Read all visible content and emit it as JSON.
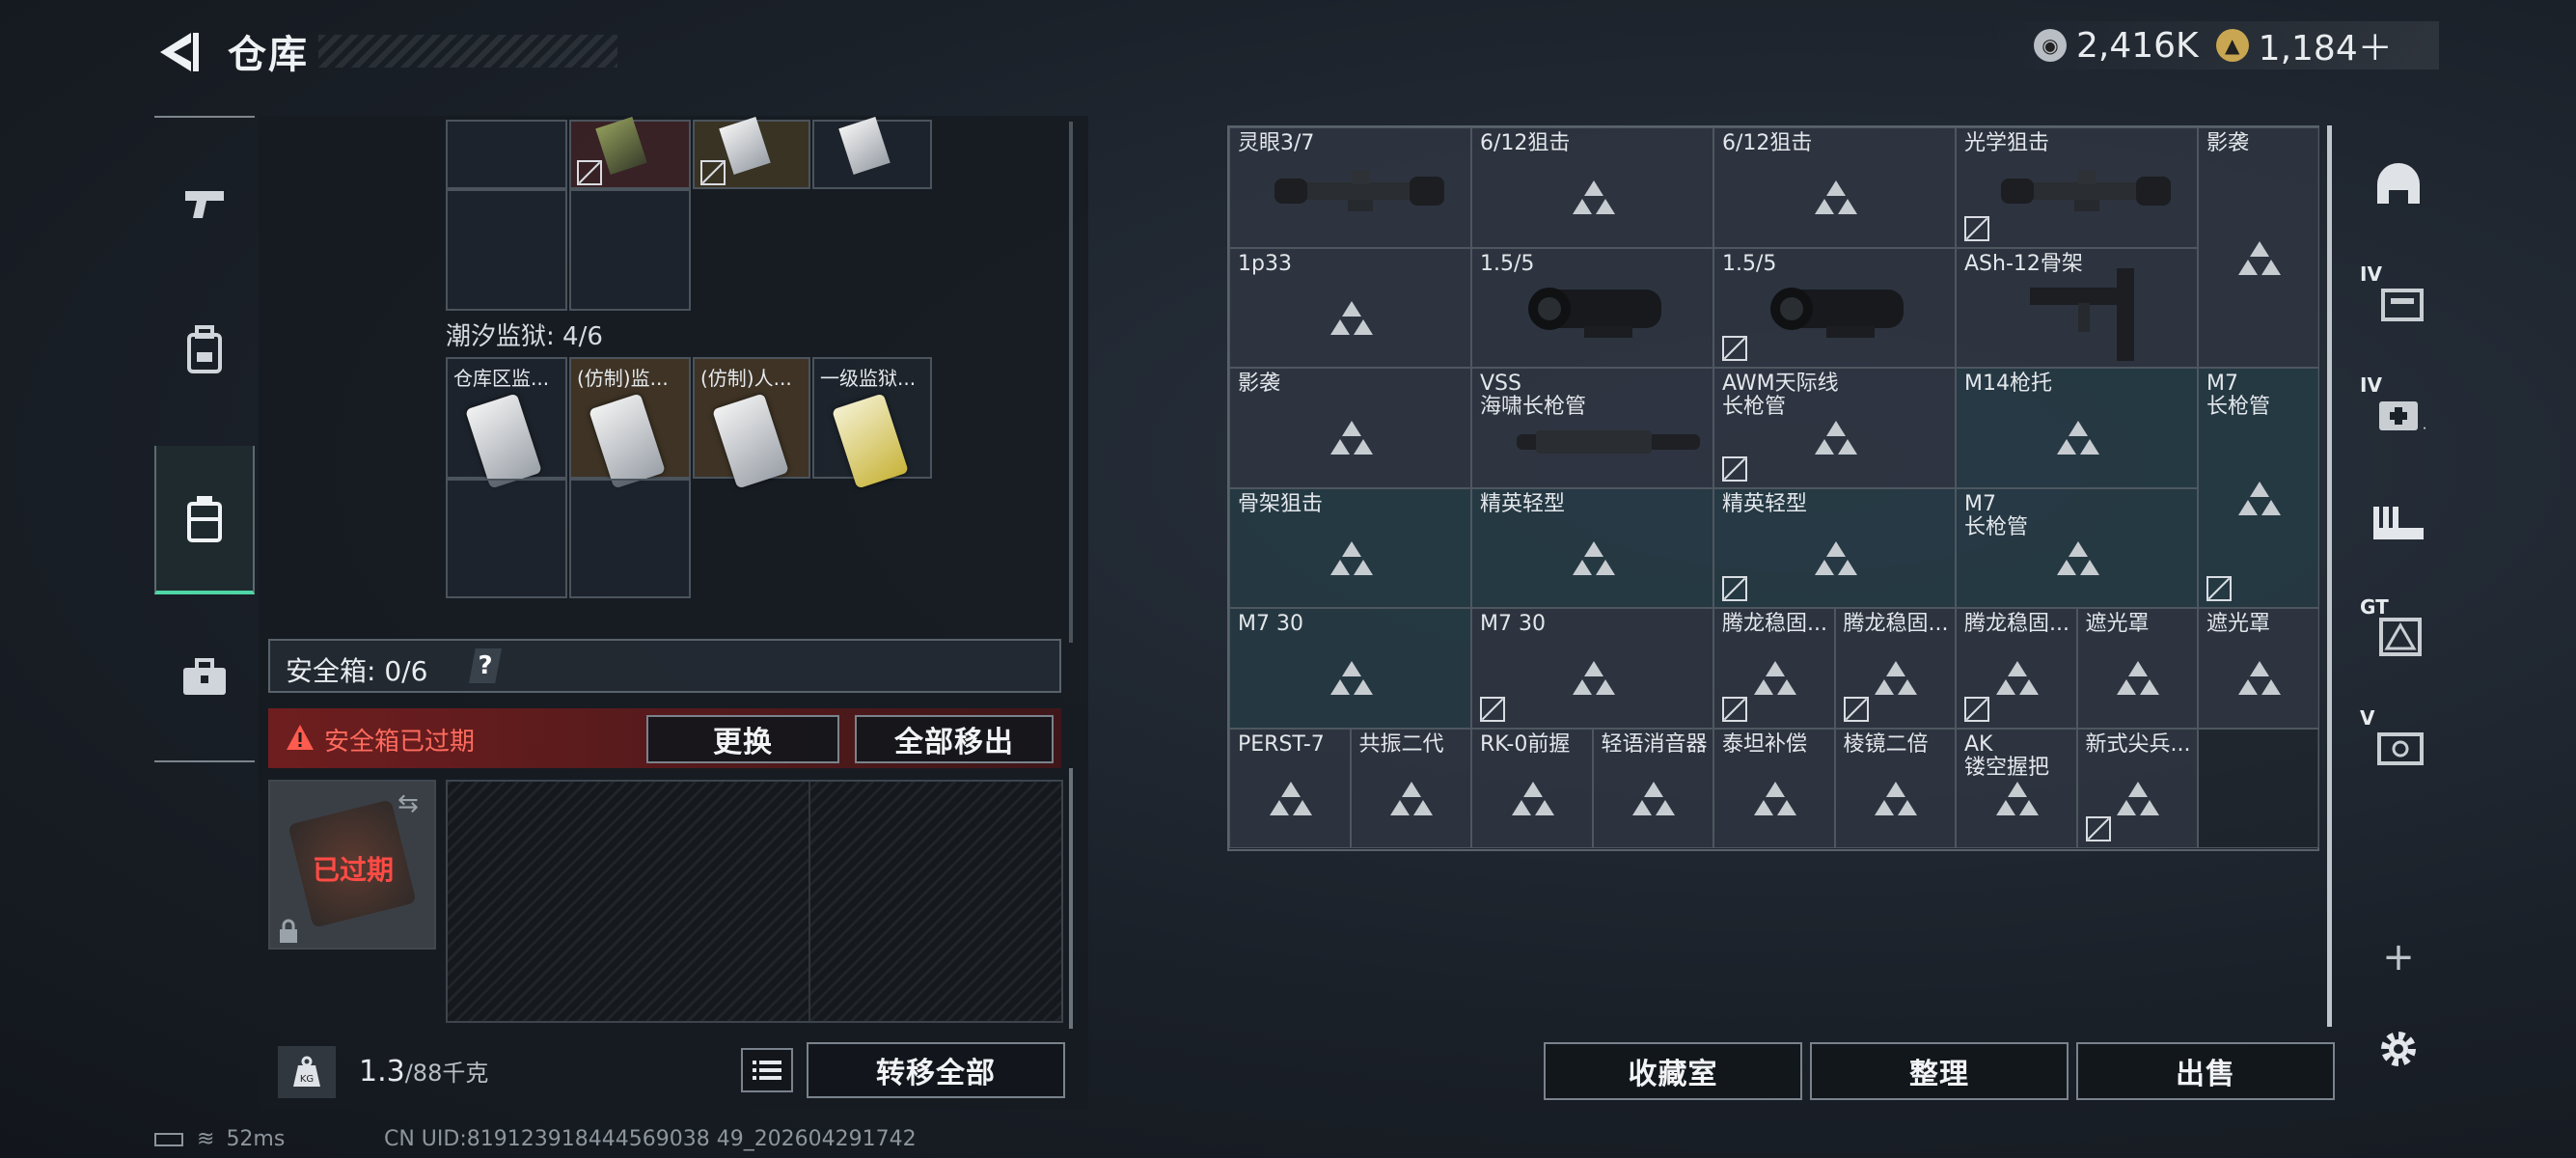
{
  "header": {
    "title": "仓库",
    "currency": [
      {
        "icon": "silver-coin-icon",
        "value": "2,416K",
        "color": "#c9ced3"
      },
      {
        "icon": "gold-coin-icon",
        "value": "1,184＋",
        "color": "#c9a651"
      }
    ]
  },
  "left_nav": [
    {
      "icon": "pistol-icon"
    },
    {
      "icon": "backpack-icon"
    },
    {
      "icon": "chest-rig-icon",
      "active": true
    },
    {
      "icon": "toolbox-icon"
    }
  ],
  "tide_prison": {
    "label": "潮汐监狱: 4/6",
    "cards": [
      "仓库区监...",
      "(仿制)监...",
      "(仿制)人...",
      "一级监狱..."
    ]
  },
  "safebox": {
    "label": "安全箱: 0/6",
    "help": "?",
    "alert": "安全箱已过期",
    "replace_btn": "更换",
    "remove_all_btn": "全部移出",
    "expired_label": "已过期"
  },
  "bottom": {
    "weight_current": "1.3",
    "weight_max": "/88千克",
    "kg_icon": "KG",
    "transfer_all_btn": "转移全部"
  },
  "status_bar": {
    "ping": "52ms",
    "uid": "CN UID:819123918444569038 49_202604291742"
  },
  "grid": {
    "cells": [
      {
        "id": "c0",
        "text": "灵眼3/7",
        "item": "scope"
      },
      {
        "id": "c1",
        "text": "6/12狙击"
      },
      {
        "id": "c2",
        "text": "6/12狙击"
      },
      {
        "id": "c3",
        "text": "光学狙击",
        "item": "scope",
        "noshow": true
      },
      {
        "id": "c4",
        "text": "影袭"
      },
      {
        "id": "c5",
        "text": "1p33"
      },
      {
        "id": "c6",
        "text": "1.5/5",
        "item": "nv"
      },
      {
        "id": "c7",
        "text": "1.5/5",
        "item": "nv",
        "noshow": true
      },
      {
        "id": "c8",
        "text": "ASh-12骨架",
        "item": "stock"
      },
      {
        "id": "c9",
        "text": "影袭"
      },
      {
        "id": "c10",
        "text": "VSS",
        "text2": "海啸长枪管",
        "item": "barrel"
      },
      {
        "id": "c11",
        "text": "AWM天际线",
        "text2": "长枪管",
        "noshow": true
      },
      {
        "id": "c12",
        "text": "M14枪托"
      },
      {
        "id": "c13",
        "text": "M7",
        "text2": "长枪管",
        "noshow": true
      },
      {
        "id": "c14",
        "text": "骨架狙击"
      },
      {
        "id": "c15",
        "text": "精英轻型"
      },
      {
        "id": "c16",
        "text": "精英轻型",
        "noshow": true
      },
      {
        "id": "c17",
        "text": "M7",
        "text2": "长枪管"
      },
      {
        "id": "c18",
        "text": "M7 30"
      },
      {
        "id": "c19",
        "text": "M7 30",
        "noshow": true
      },
      {
        "id": "c20",
        "text": "腾龙稳固...",
        "noshow": true
      },
      {
        "id": "c21",
        "text": "腾龙稳固...",
        "noshow": true
      },
      {
        "id": "c22",
        "text": "腾龙稳固...",
        "noshow": true
      },
      {
        "id": "c23",
        "text": "遮光罩"
      },
      {
        "id": "c24",
        "text": "遮光罩"
      },
      {
        "id": "c25",
        "text": "PERST-7"
      },
      {
        "id": "c26",
        "text": "共振二代"
      },
      {
        "id": "c27",
        "text": "RK-0前握"
      },
      {
        "id": "c28",
        "text": "轻语消音器"
      },
      {
        "id": "c29",
        "text": "泰坦补偿"
      },
      {
        "id": "c30",
        "text": "棱镜二倍"
      },
      {
        "id": "c31",
        "text": "AK",
        "text2": "镂空握把"
      },
      {
        "id": "c32",
        "text": "新式尖兵...",
        "noshow": true
      }
    ]
  },
  "right_nav": [
    {
      "icon": "helmet-icon"
    },
    {
      "icon": "armor-iv-icon",
      "label": "IV"
    },
    {
      "icon": "medkit-iv-icon",
      "label": "IV"
    },
    {
      "icon": "ammo-icon"
    },
    {
      "icon": "tactical-gt-icon",
      "label": "GT"
    },
    {
      "icon": "vault-v-icon",
      "label": "V"
    },
    {
      "icon": "add-tab-icon"
    },
    {
      "icon": "settings-gear-icon"
    }
  ],
  "right_buttons": {
    "collection": "收藏室",
    "sort": "整理",
    "sell": "出售"
  }
}
